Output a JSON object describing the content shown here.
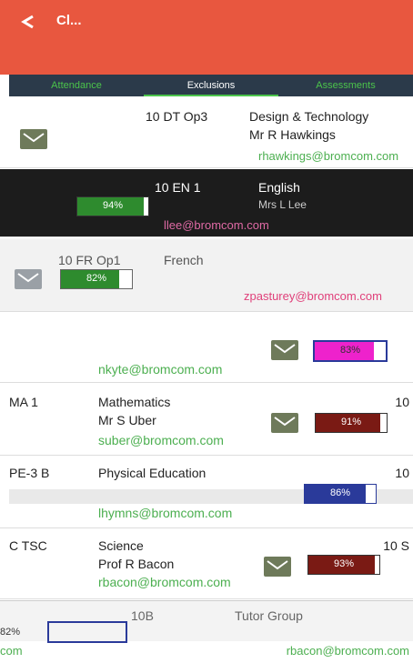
{
  "header": {
    "title": "Cl..."
  },
  "tabs": [
    {
      "label": "Attendance"
    },
    {
      "label": "Exclusions"
    },
    {
      "label": "Assessments"
    }
  ],
  "classes": [
    {
      "code": "",
      "subject": "Design & Technology",
      "group": "10 DT Op3",
      "teacher": "Mr R Hawkings",
      "email": "rhawkings@bromcom.com",
      "pct": "",
      "pct_value": 0
    },
    {
      "code": "",
      "subject": "English",
      "group": "10 EN 1",
      "teacher": "Mrs L Lee",
      "email": "llee@bromcom.com",
      "pct": "94%",
      "pct_value": 94
    },
    {
      "code": "",
      "subject": "French",
      "group": "10 FR Op1",
      "teacher": "",
      "email": "zpasturey@bromcom.com",
      "pct": "82%",
      "pct_value": 82
    },
    {
      "code": "",
      "subject": "",
      "group": "",
      "teacher": "",
      "email": "nkyte@bromcom.com",
      "pct": "83%",
      "pct_value": 83
    },
    {
      "code": "MA 1",
      "subject": "Mathematics",
      "group": "10",
      "teacher": "Mr S Uber",
      "email": "suber@bromcom.com",
      "pct": "91%",
      "pct_value": 91
    },
    {
      "code": "PE-3 B",
      "subject": "Physical Education",
      "group": "10",
      "teacher": "",
      "email": "lhymns@bromcom.com",
      "pct": "86%",
      "pct_value": 86
    },
    {
      "code": "C TSC",
      "subject": "Science",
      "group": "10 S",
      "teacher": "Prof R Bacon",
      "email": "rbacon@bromcom.com",
      "pct": "93%",
      "pct_value": 93
    }
  ],
  "bottom": {
    "tab1": "10B",
    "tab2": "Tutor Group",
    "left_pct": "82%",
    "email": "rbacon@bromcom.com",
    "left_email_fragment": "com"
  },
  "colors": {
    "header": "#e8573f",
    "accent_green": "#4caf50",
    "bar_fill": "#7a1a14",
    "mail_bg": "#6e7a5a"
  }
}
